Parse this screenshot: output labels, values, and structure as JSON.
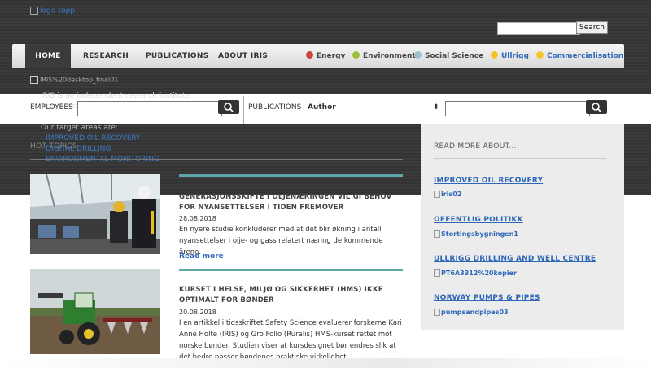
{
  "header": {
    "logo_alt": "logo-topp",
    "search_button": "Search"
  },
  "nav": {
    "items": [
      "HOME",
      "RESEARCH",
      "PUBLICATIONS",
      "ABOUT IRIS"
    ],
    "sectors": [
      {
        "label": "Energy",
        "color": "#c9463d"
      },
      {
        "label": "Environment",
        "color": "#9bbf3b"
      },
      {
        "label": "Social Science",
        "color": "#9ec3d0"
      },
      {
        "label": "Ullrigg",
        "color": "#f2c52a"
      },
      {
        "label": "Commercialisation",
        "color": "#f2c52a"
      }
    ]
  },
  "promo": {
    "image_alt": "IRIS%20desktop_final01",
    "text": "IRIS is an independent research institute with a strong focus on applied research.",
    "targets_label": "Our target areas are:",
    "targets": [
      "- IMPROVED OIL RECOVERY",
      "- DIGITAL DRILLING",
      "- ENVIRONMENTAL MONITORING"
    ]
  },
  "filters": {
    "employees_label": "EMPLOYEES",
    "publications_label": "PUBLICATIONS",
    "author_value": "Author"
  },
  "hot_topics": {
    "title": "HOT TOPICS",
    "articles": [
      {
        "title": "GENERASJONSSKIFTE I OLJENÆRINGEN VIL GI BEHOV FOR NYANSETTELSER I TIDEN FREMOVER",
        "date": "28.08.2018",
        "body": "En nyere studie konkluderer med at det blir økning i antall nyansettelser i olje- og gass relatert næring de kommende årene.",
        "more": "Read more"
      },
      {
        "title": "KURSET I HELSE, MILJØ OG SIKKERHET (HMS) IKKE OPTIMALT FOR BØNDER",
        "date": "20.08.2018",
        "body": "I en artikkel i tidsskriftet Safety Science evaluerer forskerne Kari Anne Holte (IRIS) og Gro Follo (Ruralis) HMS-kurset rettet mot norske bønder. Studien viser at kursdesignet bør endres slik at det bedre passer bøndenes praktiske virkelighet."
      }
    ]
  },
  "sidebar": {
    "title": "READ MORE ABOUT...",
    "links": [
      {
        "label": "IMPROVED OIL RECOVERY",
        "image_alt": "iris02"
      },
      {
        "label": "OFFENTLIG POLITIKK",
        "image_alt": "Stortingsbygningen1"
      },
      {
        "label": "ULLRIGG DRILLING AND WELL CENTRE",
        "image_alt": "PT6A3312%20kopier"
      },
      {
        "label": "NORWAY PUMPS & PIPES",
        "image_alt": "pumpsandpipes03"
      }
    ]
  }
}
